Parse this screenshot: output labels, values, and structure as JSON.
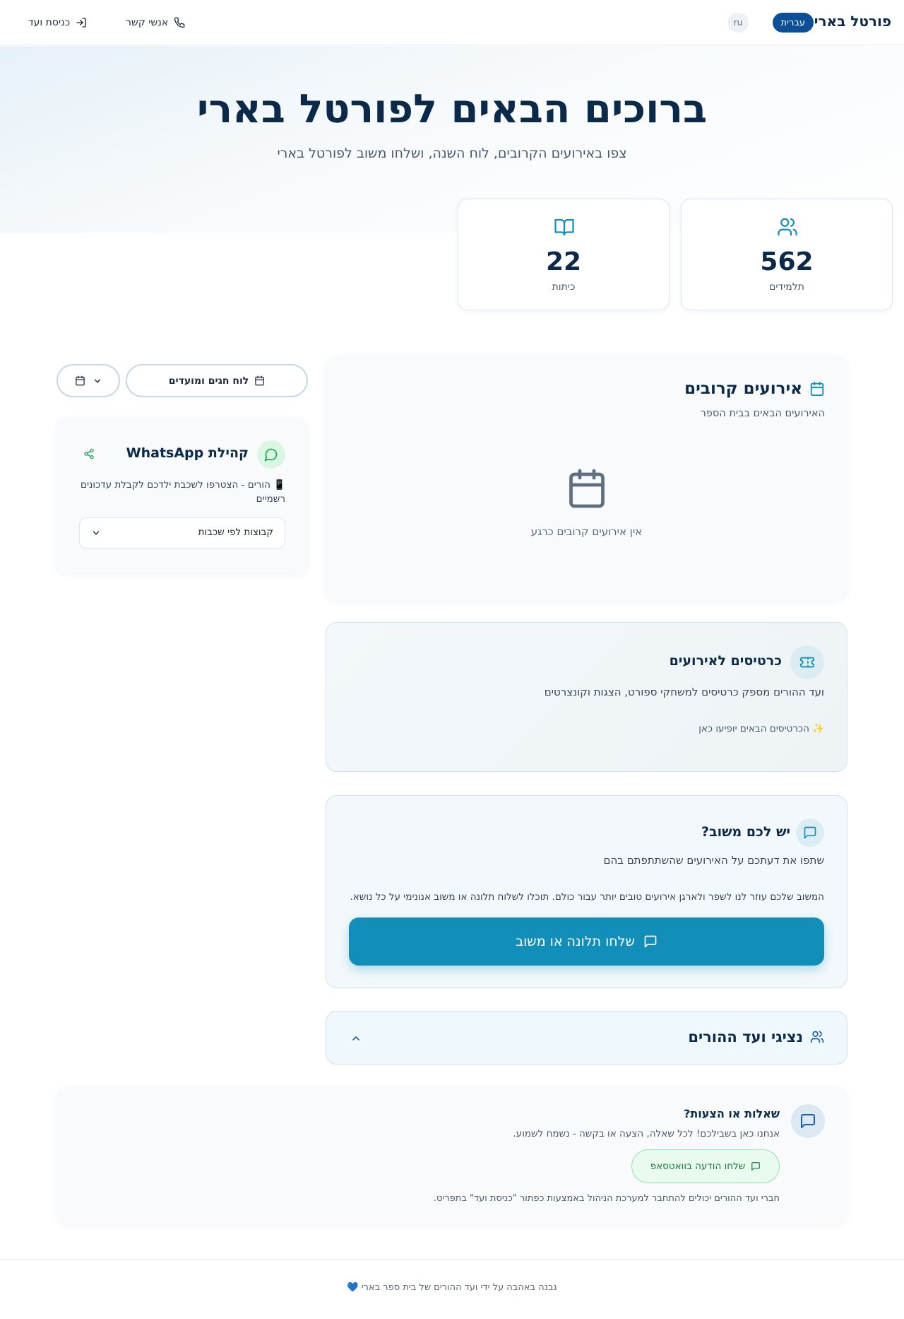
{
  "header": {
    "brand": "פורטל בארי",
    "lang_active": "עברית",
    "lang_other": "ru",
    "contacts_label": "אנשי קשר",
    "login_label": "כניסת ועד"
  },
  "hero": {
    "title": "ברוכים הבאים לפורטל בארי",
    "subtitle": "צפו באירועים הקרובים, לוח השנה, ושלחו משוב לפורטל בארי"
  },
  "stats": {
    "students": {
      "value": "562",
      "label": "תלמידים",
      "icon": "users-icon"
    },
    "classes": {
      "value": "22",
      "label": "כיתות",
      "icon": "book-icon"
    }
  },
  "actions": {
    "holidays_label": "לוח חגים ומועדים"
  },
  "whatsapp": {
    "title": "קהילת WhatsApp",
    "description": "📱 הורים - הצטרפו לשכבת ילדכם לקבלת עדכונים רשמיים",
    "select_label": "קבוצות לפי שכבות"
  },
  "events": {
    "title": "אירועים קרובים",
    "subtitle": "האירועים הבאים בבית הספר",
    "empty": "אין אירועים קרובים כרגע"
  },
  "tickets": {
    "title": "כרטיסים לאירועים",
    "subtitle": "ועד ההורים מספק כרטיסים למשחקי ספורט, הצגות וקונצרטים",
    "note": "✨ הכרטיסים הבאים יופיעו כאן"
  },
  "feedback": {
    "title": "יש לכם משוב?",
    "subtitle": "שתפו את דעתכם על האירועים שהשתתפתם בהם",
    "body": "המשוב שלכם עוזר לנו לשפר ולארגן אירועים טובים יותר עבור כולם. תוכלו לשלוח תלונה או משוב אנונימי על כל נושא.",
    "button": "שלחו תלונה או משוב"
  },
  "committee": {
    "title": "נציגי ועד ההורים"
  },
  "questions": {
    "title": "שאלות או הצעות?",
    "subtitle": "אנחנו כאן בשבילכם! לכל שאלה, הצעה או בקשה - נשמח לשמוע.",
    "button": "שלחו הודעה בוואטסאפ",
    "note": "חברי ועד ההורים יכולים להתחבר למערכת הניהול באמצעות כפתור \"כניסת ועד\" בתפריט."
  },
  "footer": {
    "text": "נבנה באהבה על ידי ועד ההורים של בית ספר בארי 💙"
  },
  "colors": {
    "primary_dark": "#0b2a4a",
    "accent_teal": "#128fb9",
    "lang_active_bg": "#0a4f97",
    "whatsapp_green": "#22a055"
  }
}
